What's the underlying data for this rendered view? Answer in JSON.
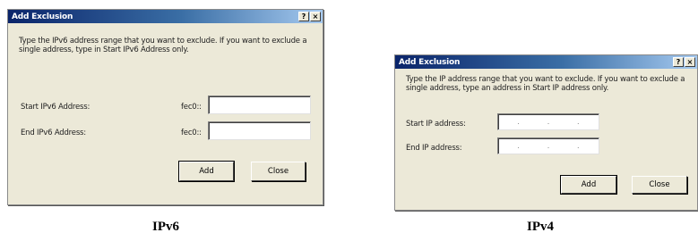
{
  "ipv6": {
    "title": "Add Exclusion",
    "help_btn": "?",
    "close_btn": "×",
    "description": "Type the IPv6 address range that you want to exclude. If you want to exclude a single address, type in Start IPv6 Address only.",
    "start_label": "Start IPv6 Address:",
    "end_label": "End IPv6 Address:",
    "start_prefix": "fec0::",
    "end_prefix": "fec0::",
    "start_value": "",
    "end_value": "",
    "add_label": "Add",
    "close_label": "Close",
    "caption": "IPv6"
  },
  "ipv4": {
    "title": "Add Exclusion",
    "help_btn": "?",
    "close_btn": "×",
    "description": "Type the IP address range that you want to exclude. If you want to exclude a single address, type an address in Start IP address only.",
    "start_label": "Start IP address:",
    "end_label": "End IP address:",
    "add_label": "Add",
    "close_label": "Close",
    "caption": "IPv4"
  }
}
